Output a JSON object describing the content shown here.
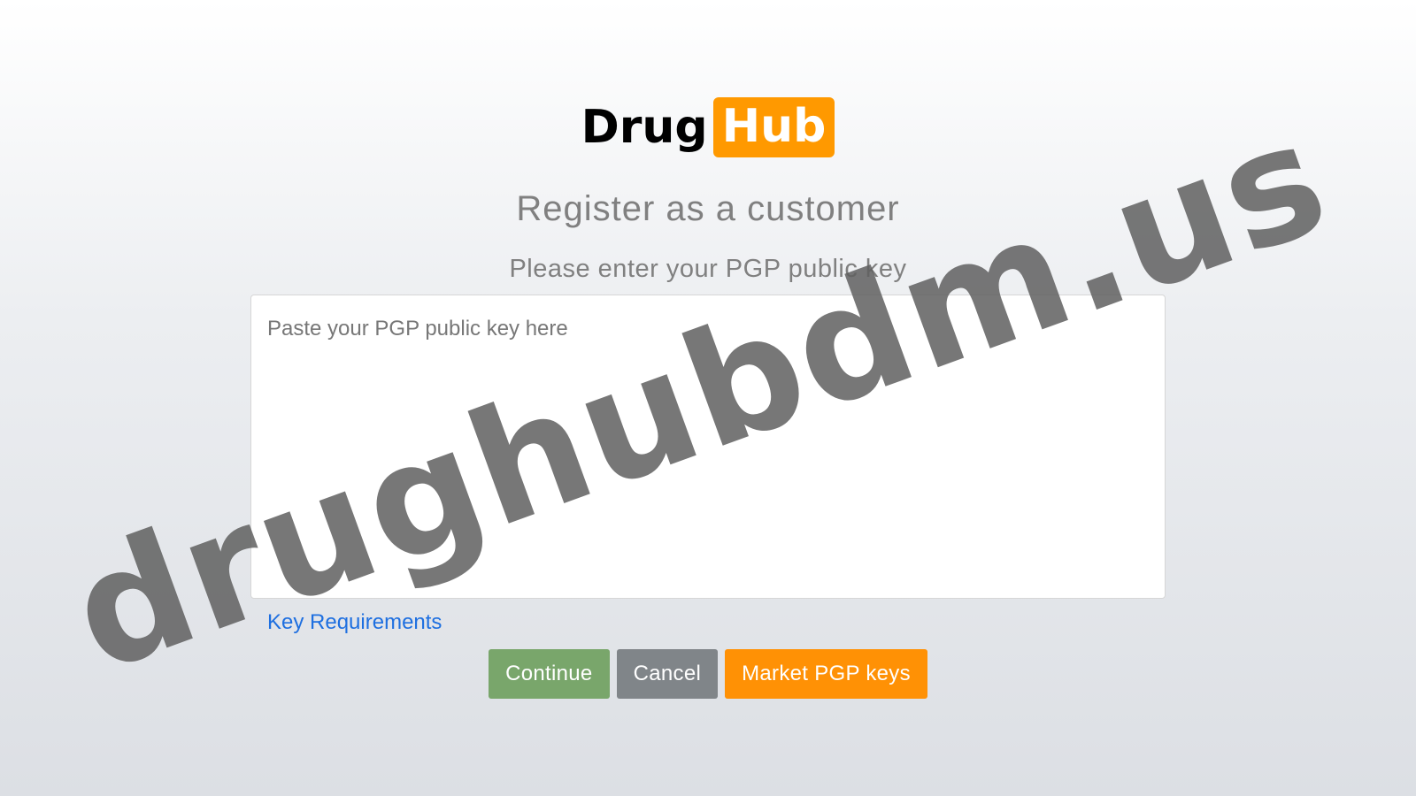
{
  "logo": {
    "left": "Drug",
    "right": "Hub"
  },
  "header": {
    "title": "Register as a customer",
    "subtitle": "Please enter your PGP public key"
  },
  "form": {
    "pgp_placeholder": "Paste your PGP public key here",
    "key_requirements_link": "Key Requirements"
  },
  "buttons": {
    "continue_label": "Continue",
    "cancel_label": "Cancel",
    "market_keys_label": "Market PGP keys"
  },
  "watermark": "drughubdm.us",
  "colors": {
    "brand_orange": "#ff9900",
    "continue_green": "#79a66b",
    "cancel_gray": "#808589",
    "link_blue": "#1e6fe0"
  }
}
